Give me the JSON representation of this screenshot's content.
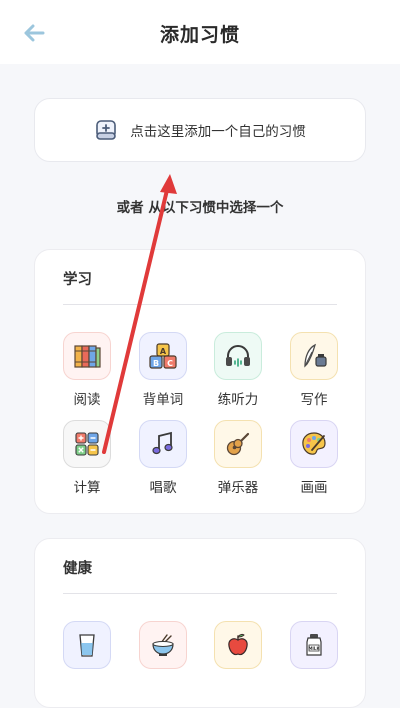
{
  "header": {
    "title": "添加习惯"
  },
  "add_card": {
    "label": "点击这里添加一个自己的习惯"
  },
  "or_text": "或者 从以下习惯中选择一个",
  "sections": [
    {
      "title": "学习",
      "items": [
        {
          "label": "阅读",
          "icon": "books-icon"
        },
        {
          "label": "背单词",
          "icon": "abc-blocks-icon"
        },
        {
          "label": "练听力",
          "icon": "headphones-icon"
        },
        {
          "label": "写作",
          "icon": "quill-ink-icon"
        },
        {
          "label": "计算",
          "icon": "calculator-icon"
        },
        {
          "label": "唱歌",
          "icon": "music-note-icon"
        },
        {
          "label": "弹乐器",
          "icon": "guitar-icon"
        },
        {
          "label": "画画",
          "icon": "palette-icon"
        }
      ]
    },
    {
      "title": "健康",
      "items": [
        {
          "label": "",
          "icon": "water-glass-icon"
        },
        {
          "label": "",
          "icon": "rice-bowl-icon"
        },
        {
          "label": "",
          "icon": "apple-icon"
        },
        {
          "label": "",
          "icon": "milk-jar-icon"
        }
      ]
    }
  ],
  "annotation": {
    "color": "#e03a3a"
  }
}
